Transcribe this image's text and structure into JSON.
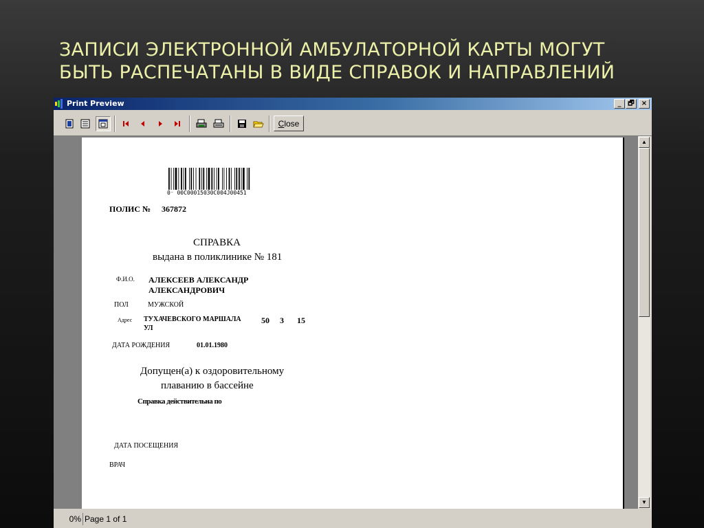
{
  "slide": {
    "title_line1": "ЗАПИСИ ЭЛЕКТРОННОЙ АМБУЛАТОРНОЙ КАРТЫ МОГУТ",
    "title_line2": "БЫТЬ РАСПЕЧАТАНЫ В ВИДЕ СПРАВОК И НАПРАВЛЕНИЙ"
  },
  "window": {
    "title": "Print Preview",
    "minimize_label": "_",
    "restore_label": "🗗",
    "close_label": "×"
  },
  "toolbar": {
    "buttons": [
      "single-page-icon",
      "two-pages-icon",
      "fit-page-icon",
      "first-page-icon",
      "prev-page-icon",
      "next-page-icon",
      "last-page-icon",
      "print-setup-icon",
      "print-icon",
      "save-icon",
      "open-icon"
    ],
    "close_mnemonic": "C",
    "close_rest": "lose"
  },
  "document": {
    "barcode_text": "0⁻ 00C00015030C004J00451",
    "policy_label": "ПОЛИС №",
    "policy_number": "367872",
    "heading": "СПРАВКА",
    "subheading": "выдана в поликлинике № 181",
    "fio_label": "Ф.И.О.",
    "fio_line1": "АЛЕКСЕЕВ АЛЕКСАНДР",
    "fio_line2": "АЛЕКСАНДРОВИЧ",
    "sex_label": "ПОЛ",
    "sex_value": "МУЖСКОЙ",
    "address_label": "Адрес",
    "address_street": "ТУХАЧЕВСКОГО МАРШАЛА",
    "address_type": "УЛ",
    "address_house": "50",
    "address_building": "3",
    "address_flat": "15",
    "dob_label": "ДАТА РОЖДЕНИЯ",
    "dob_value": "01.01.1980",
    "admission_line1": "Допущен(а) к оздоровительному",
    "admission_line2": "плаванию в бассейне",
    "valid_until": "Справка действительна по",
    "visit_date_label": "ДАТА ПОСЕЩЕНИЯ",
    "doctor_label": "ВРАЧ"
  },
  "status": {
    "zoom": "0%",
    "page_info": "Page 1 of 1"
  },
  "colors": {
    "title_text": "#ecf0a8",
    "titlebar_start": "#0a246a",
    "titlebar_end": "#a6caf0"
  }
}
